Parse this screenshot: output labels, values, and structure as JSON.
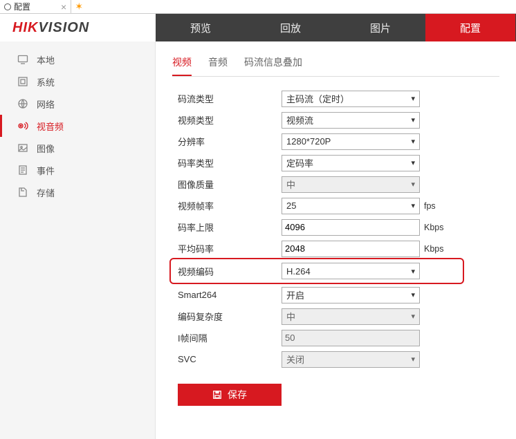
{
  "tabbar": {
    "title": "配置"
  },
  "nav": {
    "items": [
      {
        "label": "预览"
      },
      {
        "label": "回放"
      },
      {
        "label": "图片"
      },
      {
        "label": "配置",
        "active": true
      }
    ]
  },
  "sidebar": {
    "items": [
      {
        "icon": "monitor-icon",
        "label": "本地"
      },
      {
        "icon": "system-icon",
        "label": "系统"
      },
      {
        "icon": "globe-icon",
        "label": "网络"
      },
      {
        "icon": "audiovideo-icon",
        "label": "视音频",
        "active": true
      },
      {
        "icon": "image-icon",
        "label": "图像"
      },
      {
        "icon": "event-icon",
        "label": "事件"
      },
      {
        "icon": "storage-icon",
        "label": "存储"
      }
    ]
  },
  "subtabs": [
    {
      "label": "视频",
      "active": true
    },
    {
      "label": "音频"
    },
    {
      "label": "码流信息叠加"
    }
  ],
  "form": {
    "streamType": {
      "label": "码流类型",
      "value": "主码流（定时）"
    },
    "videoType": {
      "label": "视频类型",
      "value": "视频流"
    },
    "resolution": {
      "label": "分辨率",
      "value": "1280*720P"
    },
    "bitrateType": {
      "label": "码率类型",
      "value": "定码率"
    },
    "imgQuality": {
      "label": "图像质量",
      "value": "中",
      "disabled": true
    },
    "framerate": {
      "label": "视频帧率",
      "value": "25",
      "unit": "fps"
    },
    "bitrateMax": {
      "label": "码率上限",
      "value": "4096",
      "unit": "Kbps"
    },
    "avgBitrate": {
      "label": "平均码率",
      "value": "2048",
      "unit": "Kbps"
    },
    "videoCodec": {
      "label": "视频编码",
      "value": "H.264",
      "highlight": true
    },
    "smart264": {
      "label": "Smart264",
      "value": "开启"
    },
    "complexity": {
      "label": "编码复杂度",
      "value": "中",
      "disabled": true
    },
    "iInterval": {
      "label": "I帧间隔",
      "value": "50",
      "disabled": true
    },
    "svc": {
      "label": "SVC",
      "value": "关闭",
      "disabled": true
    }
  },
  "buttons": {
    "save": "保存"
  },
  "logo": {
    "hik": "HIK",
    "vision": "VISION"
  }
}
